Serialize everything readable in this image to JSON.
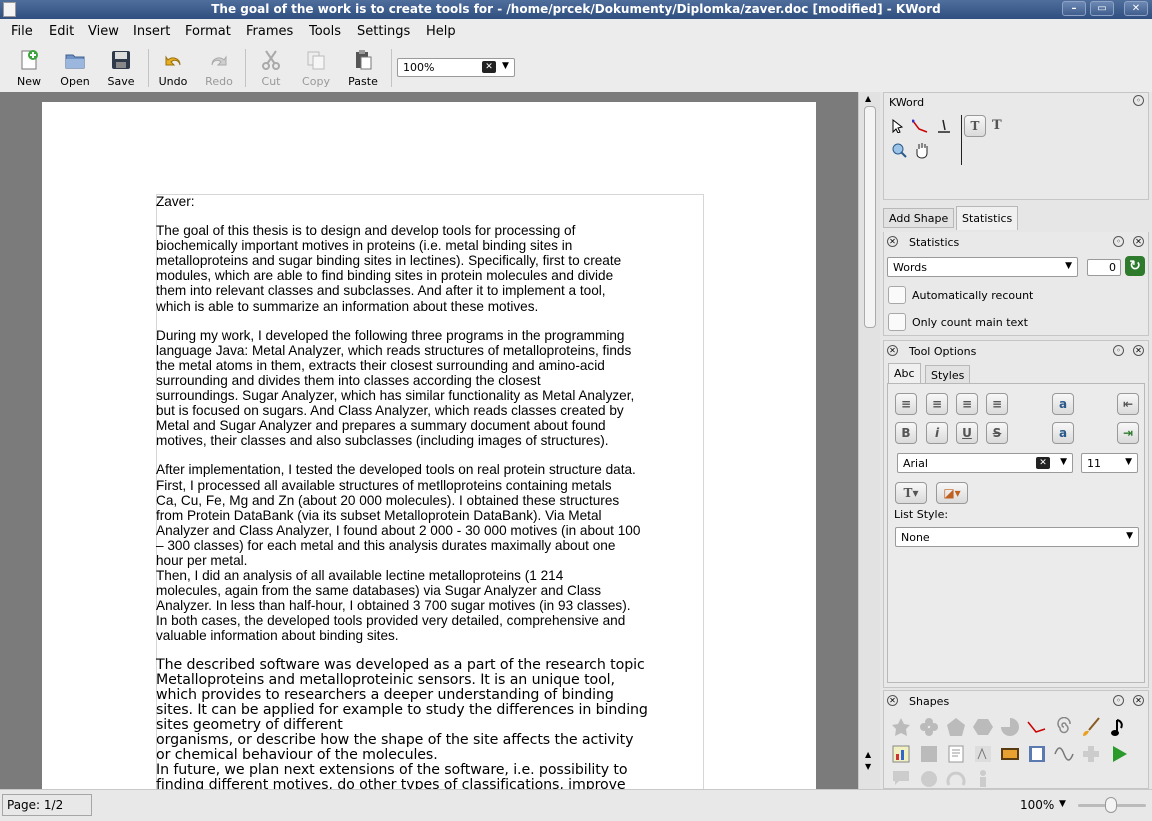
{
  "window": {
    "title": "The goal of the work is to create tools for - /home/prcek/Dokumenty/Diplomka/zaver.doc [modified] - KWord"
  },
  "menu": [
    "File",
    "Edit",
    "View",
    "Insert",
    "Format",
    "Frames",
    "Tools",
    "Settings",
    "Help"
  ],
  "toolbar": {
    "new": "New",
    "open": "Open",
    "save": "Save",
    "undo": "Undo",
    "redo": "Redo",
    "cut": "Cut",
    "copy": "Copy",
    "paste": "Paste",
    "zoom": "100%"
  },
  "document": {
    "heading": "Zaver:",
    "p1": [
      "The goal of this thesis is to design and develop tools for processing of",
      "biochemically important motives in proteins (i.e. metal binding sites in",
      "metalloproteins and sugar binding sites in lectines).  Specifically, first to create",
      "modules, which are able to find binding sites in protein molecules and divide",
      "them into relevant classes and subclasses. And after it to implement a tool,",
      "which is able to summarize an information about these motives."
    ],
    "p2": [
      "During my work, I developed the following three programs in the programming",
      "language Java: Metal Analyzer, which reads structures of metalloproteins, finds",
      "the metal atoms in them, extracts their closest surrounding and amino-acid",
      "surrounding and divides them into classes according the closest",
      "surroundings. Sugar Analyzer, which has similar functionality as Metal Analyzer,",
      "but is focused on sugars. And Class Analyzer, which reads classes created by",
      "Metal and Sugar Analyzer and prepares a summary document about found",
      "motives, their classes and also subclasses (including images of structures)."
    ],
    "p3": [
      "After implementation, I tested the developed tools on real protein structure data.",
      "First, I processed all available structures of metlloproteins containing metals",
      "Ca, Cu, Fe, Mg and Zn (about 20 000 molecules). I obtained these structures",
      "from Protein DataBank (via its subset Metalloprotein DataBank). Via Metal",
      "Analyzer and Class Analyzer, I found about 2 000 - 30 000 motives (in about 100",
      "– 300 classes) for each metal and this analysis durates maximally about one",
      "hour per metal.",
      "Then, I did an analysis of all available lectine metalloproteins (1 214",
      "molecules, again from the same databases) via Sugar Analyzer and Class",
      "Analyzer. In less than half-hour, I obtained 3 700 sugar motives (in 93 classes).",
      "In both cases, the developed tools provided very detailed, comprehensive and",
      "valuable information about binding sites."
    ],
    "p4": [
      "The described software was developed as a part of the research topic",
      "Metalloproteins and metalloproteinic sensors. It is an unique tool,",
      "which provides to researchers a deeper understanding of binding",
      "sites. It can be applied for example to study the differences in binding",
      "sites geometry of different",
      "organisms, or describe how the shape of the site affects the activity",
      "or chemical behaviour of the molecules.",
      "In future, we plan next extensions of the software, i.e. possibility to",
      "finding different motives, do other types of classifications, improve"
    ]
  },
  "docker": {
    "kword_title": "KWord",
    "tabs": [
      "Add Shape",
      "Statistics"
    ],
    "statistics": {
      "title": "Statistics",
      "mode": "Words",
      "count": "0",
      "auto_recount": "Automatically recount",
      "only_main": "Only count main text"
    },
    "tool_options": {
      "title": "Tool Options",
      "tabs": [
        "Abc",
        "Styles"
      ],
      "font": "Arial",
      "size": "11",
      "list_style_label": "List Style:",
      "list_style": "None"
    },
    "shapes_title": "Shapes"
  },
  "status": {
    "page": "Page: 1/2",
    "zoom": "100%"
  }
}
